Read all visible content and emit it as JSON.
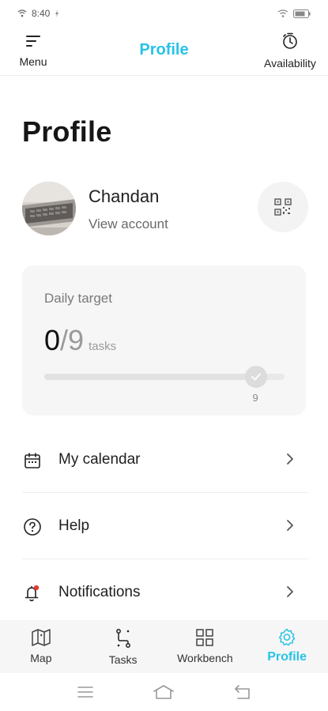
{
  "status_bar": {
    "time": "8:40"
  },
  "top_bar": {
    "menu_label": "Menu",
    "title": "Profile",
    "availability_label": "Availability"
  },
  "page": {
    "heading": "Profile"
  },
  "profile": {
    "name": "Chandan",
    "view_account": "View account"
  },
  "daily_target": {
    "label": "Daily target",
    "done": "0",
    "total": "/9",
    "unit": "tasks",
    "progress_value": "9",
    "progress_fraction": 0.88
  },
  "menu_items": [
    {
      "label": "My calendar",
      "icon": "calendar-icon"
    },
    {
      "label": "Help",
      "icon": "help-icon"
    },
    {
      "label": "Notifications",
      "icon": "bell-icon"
    }
  ],
  "bottom_nav": [
    {
      "label": "Map",
      "icon": "map-icon",
      "active": false
    },
    {
      "label": "Tasks",
      "icon": "tasks-icon",
      "active": false
    },
    {
      "label": "Workbench",
      "icon": "workbench-icon",
      "active": false
    },
    {
      "label": "Profile",
      "icon": "settings-gear-icon",
      "active": true
    }
  ],
  "colors": {
    "accent": "#27c3e6",
    "notification_dot": "#e53935"
  }
}
